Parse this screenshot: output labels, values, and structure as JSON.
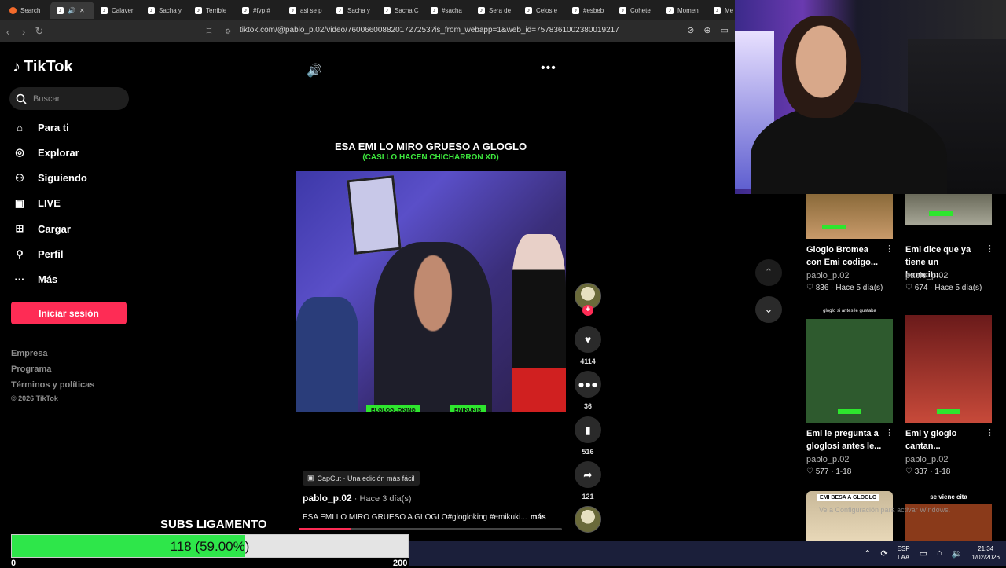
{
  "browser": {
    "tabs": [
      {
        "label": "Search"
      },
      {
        "label": "🔊"
      },
      {
        "label": "Calaver"
      },
      {
        "label": "Sacha y"
      },
      {
        "label": "Terrible"
      },
      {
        "label": "#fyp #"
      },
      {
        "label": "asi se p"
      },
      {
        "label": "Sacha y"
      },
      {
        "label": "Sacha C"
      },
      {
        "label": "#sacha"
      },
      {
        "label": "Sera de"
      },
      {
        "label": "Celos e"
      },
      {
        "label": "#esbeb"
      },
      {
        "label": "Cohete"
      },
      {
        "label": "Momen"
      },
      {
        "label": "Me"
      }
    ],
    "url": "tiktok.com/@pablo_p.02/video/7600660088201727253?is_from_webapp=1&web_id=7578361002380019217"
  },
  "sidebar": {
    "logo": "TikTok",
    "search_placeholder": "Buscar",
    "nav": [
      {
        "label": "Para ti",
        "icon": "home-icon"
      },
      {
        "label": "Explorar",
        "icon": "compass-icon"
      },
      {
        "label": "Siguiendo",
        "icon": "following-icon"
      },
      {
        "label": "LIVE",
        "icon": "live-icon"
      },
      {
        "label": "Cargar",
        "icon": "upload-icon"
      },
      {
        "label": "Perfil",
        "icon": "profile-icon"
      },
      {
        "label": "Más",
        "icon": "more-icon"
      }
    ],
    "login": "Iniciar sesión",
    "footer": [
      "Empresa",
      "Programa",
      "Términos y políticas"
    ],
    "copyright": "© 2026 TikTok"
  },
  "video": {
    "overlay_title": "ESA EMI LO MIRO GRUESO A GLOGLO",
    "overlay_subtitle": "(CASI LO HACEN CHICHARRON XD)",
    "tag_left": "ELGLOGLOKING",
    "tag_right": "EMIKUKIS",
    "capcut": "CapCut · Una edición más fácil",
    "author": "pablo_p.02",
    "ago": " · Hace 3 día(s)",
    "caption": "ESA EMI LO MIRO GRUESO A GLOGLO#glogloking #emikuki...",
    "more": "más",
    "progress": 0.2
  },
  "actions": {
    "likes": "4114",
    "comments": "36",
    "saves": "516",
    "shares": "121"
  },
  "feed": [
    {
      "title": "Gloglo Bromea con Emi codigo...",
      "author": "pablo_p.02",
      "likes": "836",
      "ago": "Hace 5 día(s)"
    },
    {
      "title": "Emi dice que ya tiene un leoncito...",
      "author": "pablo_p.02",
      "likes": "674",
      "ago": "Hace 5 día(s)"
    },
    {
      "title": "Emi le pregunta a gloglosi antes le...",
      "author": "pablo_p.02",
      "likes": "577",
      "ago": "1-18"
    },
    {
      "title": "Emi y gloglo cantan...",
      "author": "pablo_p.02",
      "likes": "337",
      "ago": "1-18"
    }
  ],
  "feed_thumb_text": {
    "t3_top": "gloglo si antes le gustaba",
    "t5": "EMI BESA A GLOGLO",
    "t6": "se viene cita"
  },
  "watermark": "Ve a Configuración para activar Windows.",
  "stream": {
    "subs_label": "SUBS LIGAMENTO",
    "subs_text": "118 (59.00%)",
    "subs_fraction": 0.59,
    "low_left": "0",
    "low_right": "200"
  },
  "taskbar": {
    "lang_top": "ESP",
    "lang_bottom": "LAA",
    "time": "21:34",
    "date": "1/02/2026"
  }
}
